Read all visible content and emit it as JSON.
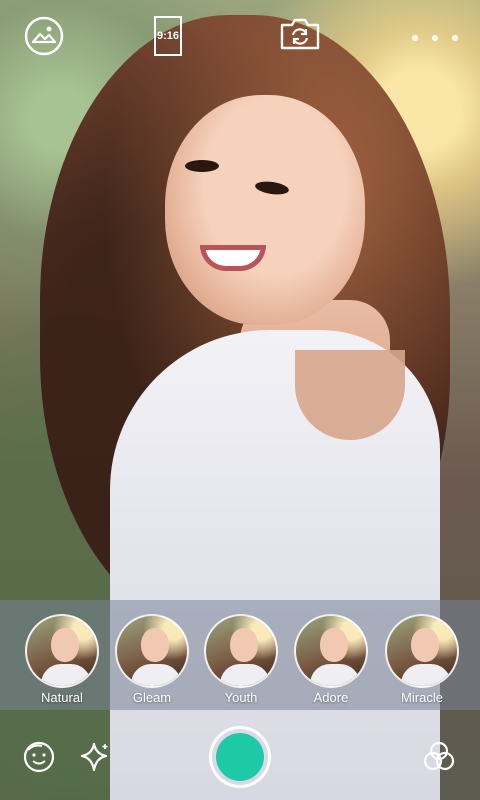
{
  "topbar": {
    "gallery_icon": "gallery-icon",
    "ratio_label": "9:16",
    "flip_icon": "camera-flip-icon",
    "more_icon": "more-dots-icon"
  },
  "filters": [
    {
      "label": "Natural"
    },
    {
      "label": "Gleam"
    },
    {
      "label": "Youth"
    },
    {
      "label": "Adore"
    },
    {
      "label": "Miracle"
    }
  ],
  "bottombar": {
    "beauty_icon": "face-beauty-icon",
    "sparkle_icon": "sparkle-icon",
    "shutter_color": "#1ec9a8",
    "filters_icon": "color-circles-icon"
  }
}
